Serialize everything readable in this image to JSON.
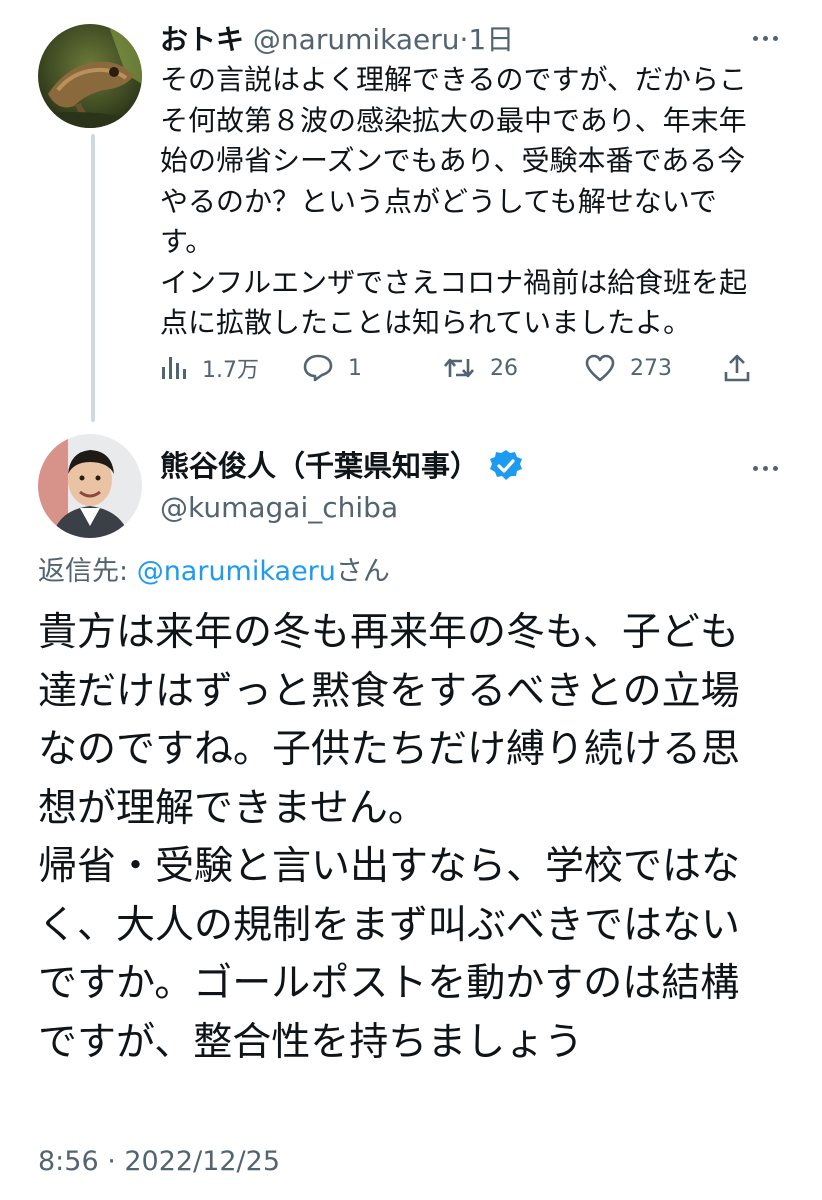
{
  "tweet1": {
    "author_name": "おトキ",
    "author_handle": "@narumikaeru",
    "separator": "·",
    "time_ago": "1日",
    "body_lines": [
      "その言説はよく理解できるのですが、だからこ",
      "そ何故第８波の感染拡大の最中であり、年末年",
      "始の帰省シーズンでもあり、受験本番である今",
      "やるのか？という点がどうしても解せないで",
      "す。",
      "インフルエンザでさえコロナ禍前は給食班を起",
      "点に拡散したことは知られていましたよ。"
    ],
    "metrics": {
      "views": "1.7万",
      "replies": "1",
      "retweets": "26",
      "likes": "273"
    },
    "avatar_icon": "frog-photo-avatar"
  },
  "tweet2": {
    "author_name": "熊谷俊人（千葉県知事）",
    "author_handle": "@kumagai_chiba",
    "verified_icon": "verified-badge-icon",
    "reply_prefix": "返信先: ",
    "reply_mention": "@narumikaeru",
    "reply_suffix": "さん",
    "body_lines": [
      "貴方は来年の冬も再来年の冬も、子ども",
      "達だけはずっと黙食をするべきとの立場",
      "なのですね。子供たちだけ縛り続ける思",
      "想が理解できません。",
      "帰省・受験と言い出すなら、学校ではな",
      "く、大人の規制をまず叫ぶべきではない",
      "ですか。ゴールポストを動かすのは結構",
      "ですが、整合性を持ちましょう"
    ],
    "timestamp": "8:56 · 2022/12/25",
    "avatar_icon": "man-portrait-avatar"
  },
  "colors": {
    "text_primary": "#0f1419",
    "text_secondary": "#536471",
    "accent_blue": "#1d9bf0",
    "thread_line": "#cfd9de"
  }
}
